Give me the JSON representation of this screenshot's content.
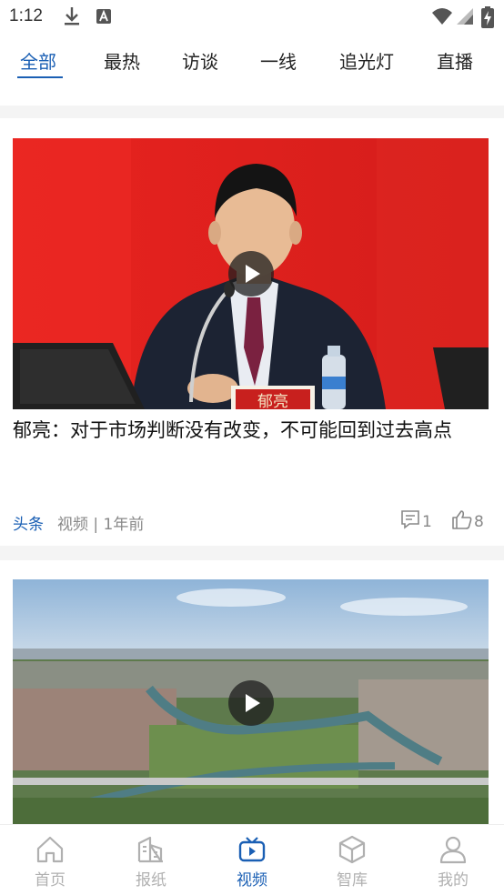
{
  "status_bar": {
    "time": "1:12"
  },
  "tabs": [
    {
      "label": "全部",
      "active": true
    },
    {
      "label": "最热"
    },
    {
      "label": "访谈"
    },
    {
      "label": "一线"
    },
    {
      "label": "追光灯"
    },
    {
      "label": "直播"
    }
  ],
  "cards": [
    {
      "title": "郁亮：对于市场判断没有改变，不可能回到过去高点",
      "tag": "头条",
      "category": "视频",
      "time": "1年前",
      "comments": "1",
      "likes": "8",
      "nameplate": "郁亮"
    }
  ],
  "bottom_nav": [
    {
      "label": "首页",
      "icon": "home-icon"
    },
    {
      "label": "报纸",
      "icon": "newspaper-icon"
    },
    {
      "label": "视频",
      "icon": "tv-icon",
      "active": true
    },
    {
      "label": "智库",
      "icon": "cube-icon"
    },
    {
      "label": "我的",
      "icon": "user-icon"
    }
  ],
  "colors": {
    "accent": "#1a5fb4",
    "inactive": "#b0b0b0",
    "meta": "#888888"
  }
}
